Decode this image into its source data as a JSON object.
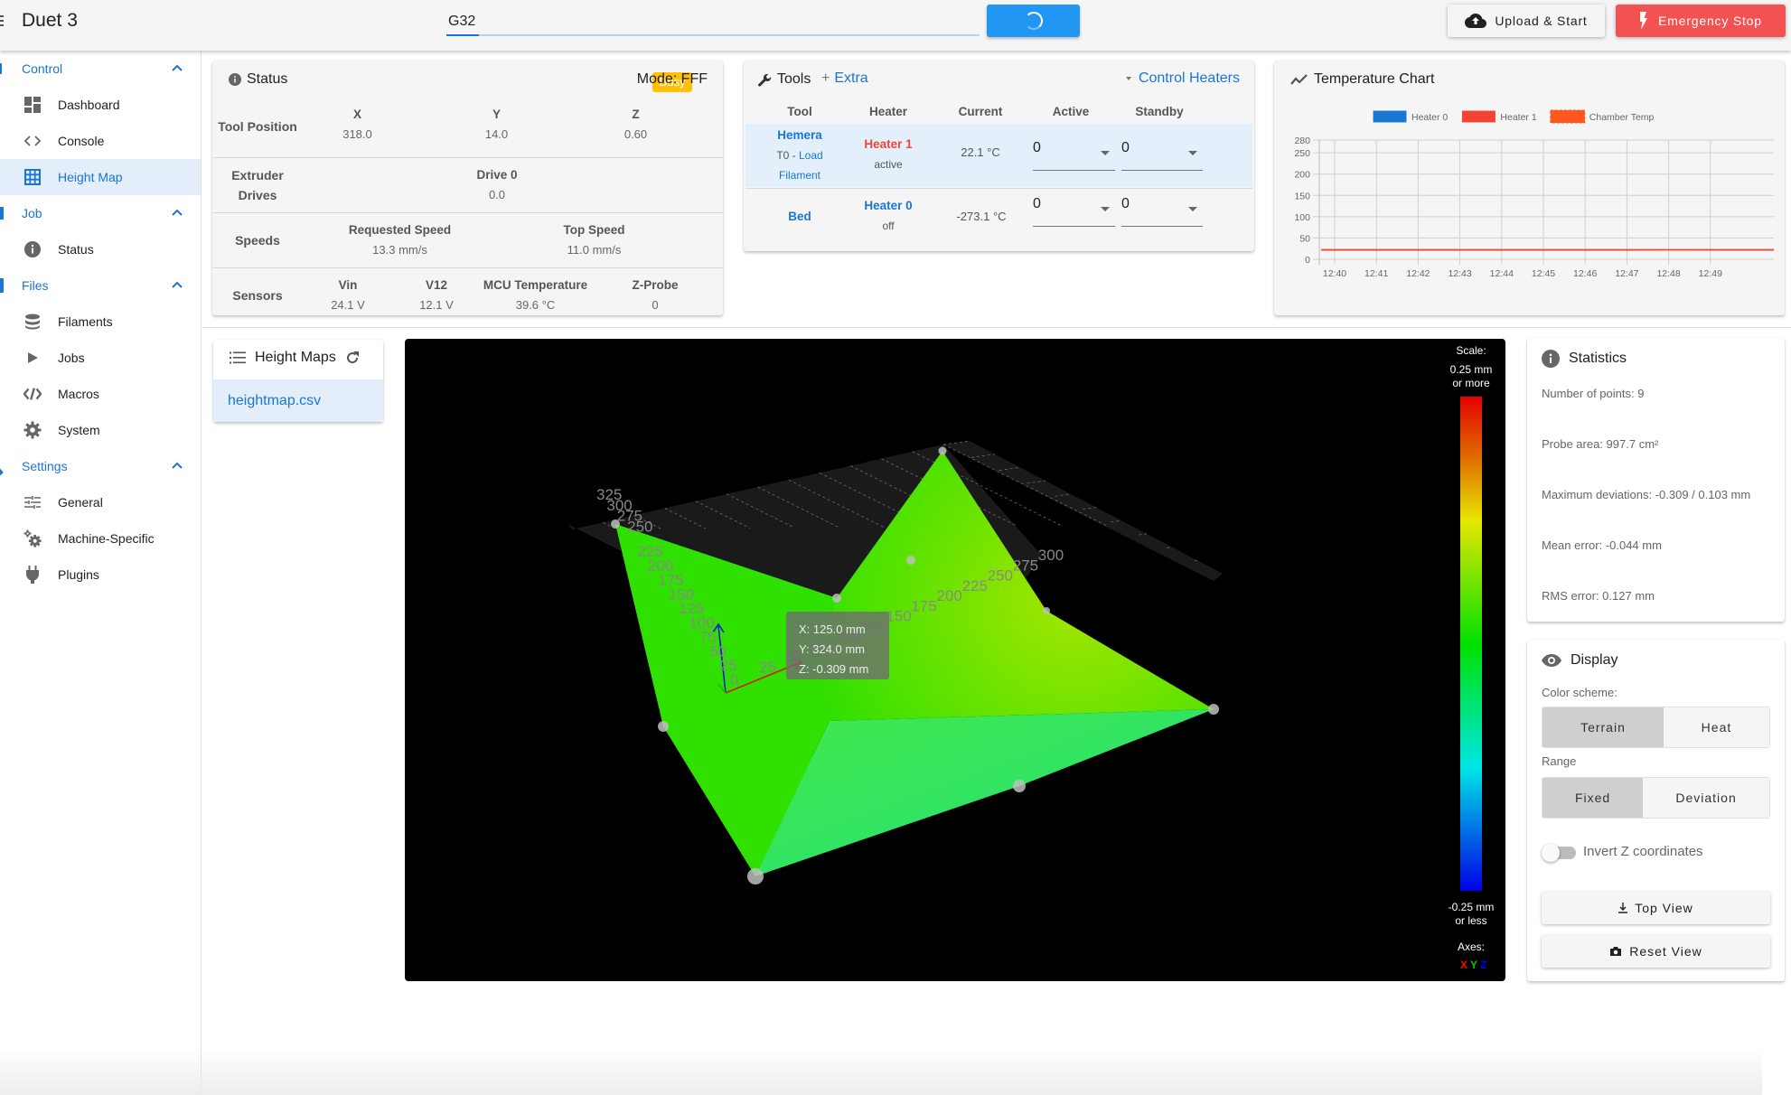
{
  "header": {
    "app_title": "Duet 3",
    "code_input_value": "G32",
    "upload_label": "Upload & Start",
    "estop_label": "Emergency Stop"
  },
  "sidebar": {
    "groups": [
      {
        "label": "Control",
        "items": [
          {
            "label": "Dashboard",
            "icon": "dashboard-icon"
          },
          {
            "label": "Console",
            "icon": "code-icon"
          },
          {
            "label": "Height Map",
            "icon": "grid-icon",
            "active": true
          }
        ]
      },
      {
        "label": "Job",
        "items": [
          {
            "label": "Status",
            "icon": "info-icon"
          }
        ]
      },
      {
        "label": "Files",
        "items": [
          {
            "label": "Filaments",
            "icon": "database-icon"
          },
          {
            "label": "Jobs",
            "icon": "play-icon"
          },
          {
            "label": "Macros",
            "icon": "code-slash-icon"
          },
          {
            "label": "System",
            "icon": "gear-icon"
          }
        ]
      },
      {
        "label": "Settings",
        "items": [
          {
            "label": "General",
            "icon": "tune-icon"
          },
          {
            "label": "Machine-Specific",
            "icon": "gears-icon"
          },
          {
            "label": "Plugins",
            "icon": "plug-icon"
          }
        ]
      }
    ]
  },
  "status": {
    "title": "Status",
    "badge": "Busy",
    "mode": "Mode: FFF",
    "tool_position": {
      "label": "Tool Position",
      "cols": [
        {
          "h": "X",
          "v": "318.0"
        },
        {
          "h": "Y",
          "v": "14.0"
        },
        {
          "h": "Z",
          "v": "0.60"
        }
      ]
    },
    "extruder": {
      "label_line1": "Extruder",
      "label_line2": "Drives",
      "cols": [
        {
          "h": "Drive 0",
          "v": "0.0"
        }
      ]
    },
    "speeds": {
      "label": "Speeds",
      "cols": [
        {
          "h": "Requested Speed",
          "v": "13.3 mm/s"
        },
        {
          "h": "Top Speed",
          "v": "11.0 mm/s"
        }
      ]
    },
    "sensors": {
      "label": "Sensors",
      "cols": [
        {
          "h": "Vin",
          "v": "24.1 V"
        },
        {
          "h": "V12",
          "v": "12.1 V"
        },
        {
          "h": "MCU Temperature",
          "v": "39.6 °C"
        },
        {
          "h": "Z-Probe",
          "v": "0"
        }
      ]
    }
  },
  "tools": {
    "title": "Tools",
    "extra_label": "Extra",
    "control_heaters_label": "Control Heaters",
    "headers": [
      "Tool",
      "Heater",
      "Current",
      "Active",
      "Standby"
    ],
    "rows": [
      {
        "tool": "Hemera",
        "tool_sub_prefix": "T0 - ",
        "tool_sub_link1": "Load",
        "tool_sub_link2": "Filament",
        "heater": "Heater 1",
        "heater_state": "active",
        "current": "22.1 °C",
        "active": "0",
        "standby": "0"
      },
      {
        "tool": "Bed",
        "heater": "Heater 0",
        "heater_state": "off",
        "current": "-273.1 °C",
        "active": "0",
        "standby": "0"
      }
    ]
  },
  "temp_chart": {
    "title": "Temperature Chart"
  },
  "chart_data": {
    "type": "line",
    "title": "Temperature Chart",
    "xlabel": "",
    "ylabel": "",
    "x": [
      "12:40",
      "12:41",
      "12:42",
      "12:43",
      "12:44",
      "12:45",
      "12:46",
      "12:47",
      "12:48",
      "12:49"
    ],
    "ylim": [
      0,
      280
    ],
    "yticks": [
      0,
      50,
      100,
      150,
      200,
      250,
      280
    ],
    "grid": true,
    "legend": "top-center",
    "series": [
      {
        "name": "Heater 0",
        "color": "#1976d2",
        "values": []
      },
      {
        "name": "Heater 1",
        "color": "#f44336",
        "values": [
          22.1,
          22.1,
          22.1,
          22.1,
          22.1,
          22.1,
          22.1,
          22.2,
          22.1,
          22.1
        ]
      },
      {
        "name": "Chamber Temp",
        "color": "#ff5722",
        "dashed": true,
        "values": []
      }
    ]
  },
  "height_maps": {
    "title": "Height Maps",
    "files": [
      "heightmap.csv"
    ]
  },
  "heightmap_view": {
    "scale_title": "Scale:",
    "scale_max_line1": "0.25 mm",
    "scale_max_line2": "or more",
    "scale_min_line1": "-0.25 mm",
    "scale_min_line2": "or less",
    "axes_title": "Axes:",
    "axes": [
      {
        "label": "X",
        "color": "#ff0000"
      },
      {
        "label": "Y",
        "color": "#00cc00"
      },
      {
        "label": "Z",
        "color": "#0000ff"
      }
    ],
    "y_ticks": [
      "325",
      "300",
      "275",
      "250",
      "225",
      "200",
      "175",
      "150",
      "125",
      "100",
      "75",
      "50",
      "25",
      "0"
    ],
    "x_ticks": [
      "25",
      "50",
      "75",
      "100",
      "125",
      "150",
      "175",
      "200",
      "225",
      "250",
      "275",
      "300"
    ],
    "tooltip": {
      "x": "X: 125.0 mm",
      "y": "Y: 324.0 mm",
      "z": "Z: -0.309 mm"
    }
  },
  "statistics": {
    "title": "Statistics",
    "lines": [
      "Number of points: 9",
      "Probe area: 997.7 cm²",
      "Maximum deviations: -0.309 / 0.103 mm",
      "Mean error: -0.044 mm",
      "RMS error: 0.127 mm"
    ]
  },
  "display": {
    "title": "Display",
    "color_scheme_label": "Color scheme:",
    "color_scheme_options": [
      "Terrain",
      "Heat"
    ],
    "color_scheme_selected": "Terrain",
    "range_label": "Range",
    "range_options": [
      "Fixed",
      "Deviation"
    ],
    "range_selected": "Fixed",
    "invert_z_label": "Invert Z coordinates",
    "invert_z": false,
    "top_view_label": "Top View",
    "reset_view_label": "Reset View"
  }
}
